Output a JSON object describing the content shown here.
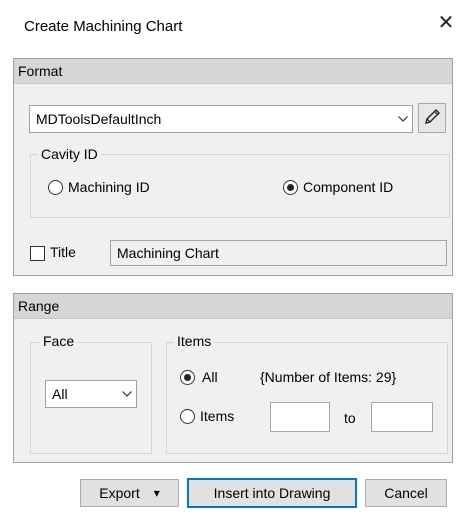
{
  "dialog": {
    "title": "Create Machining Chart",
    "close_glyph": "✕"
  },
  "format": {
    "header": "Format",
    "format_value": "MDToolsDefaultInch",
    "edit_icon": "pencil-icon",
    "cavity_id": {
      "label": "Cavity ID",
      "options": [
        {
          "label": "Machining ID",
          "checked": false
        },
        {
          "label": "Component ID",
          "checked": true
        }
      ]
    },
    "title": {
      "label": "Title",
      "checked": false,
      "value": "Machining Chart"
    }
  },
  "range": {
    "header": "Range",
    "face": {
      "label": "Face",
      "value": "All"
    },
    "items": {
      "label": "Items",
      "all_label": "All",
      "all_checked": true,
      "count_text": "{Number of Items: 29}",
      "items_label": "Items",
      "items_checked": false,
      "from_value": "",
      "to_label": "to",
      "to_value": ""
    }
  },
  "buttons": {
    "export": "Export",
    "export_arrow": "▾",
    "insert": "Insert into Drawing",
    "cancel": "Cancel"
  }
}
